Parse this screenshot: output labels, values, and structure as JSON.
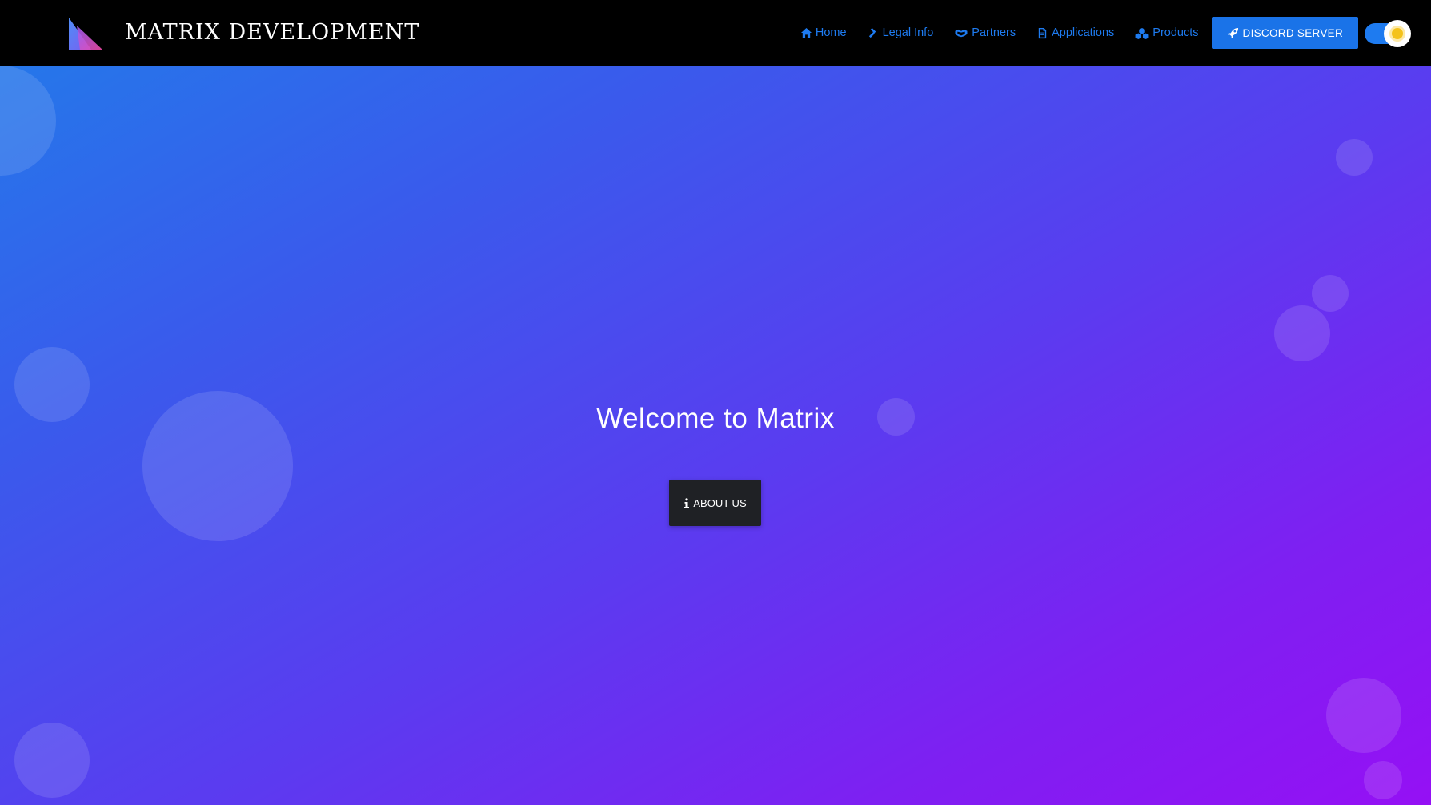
{
  "header": {
    "brand_title": "MATRIX DEVELOPMENT",
    "nav": {
      "home": "Home",
      "legal": "Legal Info",
      "partners": "Partners",
      "applications": "Applications",
      "products": "Products"
    },
    "discord_label": "DISCORD SERVER",
    "theme_toggle": "light-mode"
  },
  "hero": {
    "title": "Welcome to Matrix",
    "about_label": "ABOUT US"
  },
  "colors": {
    "navbar_bg": "#000000",
    "nav_link": "#1e7bf0",
    "discord_button": "#1a73e8",
    "about_button": "#1f2125",
    "gradient_start": "#2577ea",
    "gradient_end": "#9510f4"
  },
  "icons": {
    "home": "home-icon",
    "legal": "gavel-icon",
    "partners": "handshake-icon",
    "applications": "document-icon",
    "products": "cubes-icon",
    "discord": "rocket-icon",
    "theme": "sun-icon",
    "about": "info-icon"
  }
}
